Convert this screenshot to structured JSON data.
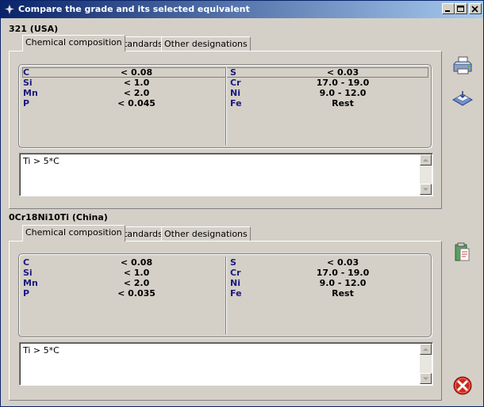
{
  "window": {
    "title": "Compare the grade and its selected equivalent"
  },
  "grade1": {
    "label": "321 (USA)",
    "tabs": [
      {
        "label": "Chemical composition"
      },
      {
        "label": "Standards"
      },
      {
        "label": "Other designations"
      }
    ],
    "composition_left": [
      {
        "element": "C",
        "value": "< 0.08"
      },
      {
        "element": "Si",
        "value": "< 1.0"
      },
      {
        "element": "Mn",
        "value": "< 2.0"
      },
      {
        "element": "P",
        "value": "< 0.045"
      }
    ],
    "composition_right": [
      {
        "element": "S",
        "value": "< 0.03"
      },
      {
        "element": "Cr",
        "value": "17.0 - 19.0"
      },
      {
        "element": "Ni",
        "value": "9.0 - 12.0"
      },
      {
        "element": "Fe",
        "value": "Rest"
      }
    ],
    "note": "Ti > 5*C"
  },
  "grade2": {
    "label": "0Cr18Ni10Ti (China)",
    "tabs": [
      {
        "label": "Chemical composition"
      },
      {
        "label": "Standards"
      },
      {
        "label": "Other designations"
      }
    ],
    "composition_left": [
      {
        "element": "C",
        "value": "< 0.08"
      },
      {
        "element": "Si",
        "value": "< 1.0"
      },
      {
        "element": "Mn",
        "value": "< 2.0"
      },
      {
        "element": "P",
        "value": "< 0.035"
      }
    ],
    "composition_right": [
      {
        "element": "S",
        "value": "< 0.03"
      },
      {
        "element": "Cr",
        "value": "17.0 - 19.0"
      },
      {
        "element": "Ni",
        "value": "9.0 - 12.0"
      },
      {
        "element": "Fe",
        "value": "Rest"
      }
    ],
    "note": "Ti > 5*C"
  },
  "icons": {
    "print": "printer-icon",
    "export": "export-icon",
    "clipboard": "clipboard-icon",
    "close": "close-circle-icon"
  },
  "colors": {
    "element_label": "#1a1a7e",
    "close_red": "#cc2a1e"
  }
}
